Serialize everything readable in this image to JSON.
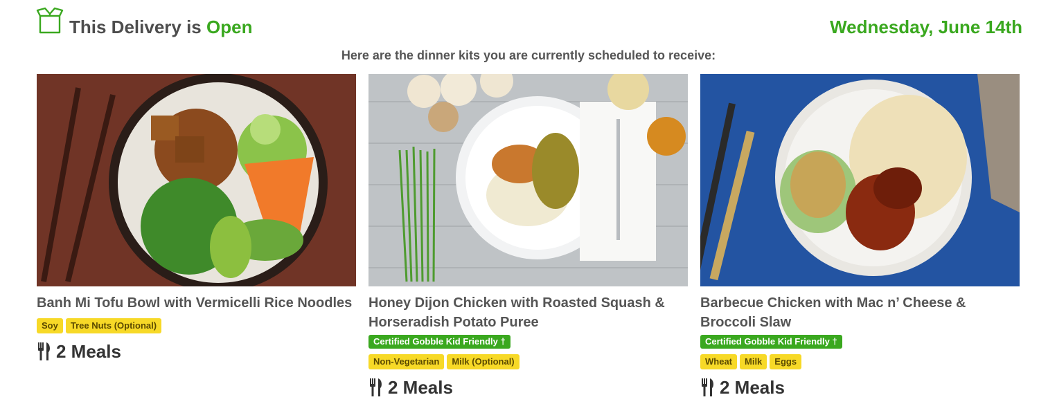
{
  "header": {
    "title_prefix": "This Delivery is",
    "status": "Open",
    "date": "Wednesday, June 14th",
    "icon": "box-icon"
  },
  "subtitle": "Here are the dinner kits you are currently scheduled to receive:",
  "meals": [
    {
      "name": "Banh Mi Tofu Bowl with Vermicelli Rice Noodles",
      "kid_friendly": "",
      "tags": [
        "Soy",
        "Tree Nuts (Optional)"
      ],
      "count": "2 Meals"
    },
    {
      "name": "Honey Dijon Chicken with Roasted Squash & Horseradish Potato Puree",
      "kid_friendly": "Certified Gobble Kid Friendly",
      "tags": [
        "Non-Vegetarian",
        "Milk (Optional)"
      ],
      "count": "2 Meals"
    },
    {
      "name": "Barbecue Chicken with Mac n’ Cheese & Broccoli Slaw",
      "kid_friendly": "Certified Gobble Kid Friendly",
      "tags": [
        "Wheat",
        "Milk",
        "Eggs"
      ],
      "count": "2 Meals"
    }
  ],
  "colors": {
    "accent": "#3aa81f",
    "tag": "#f7d927"
  }
}
